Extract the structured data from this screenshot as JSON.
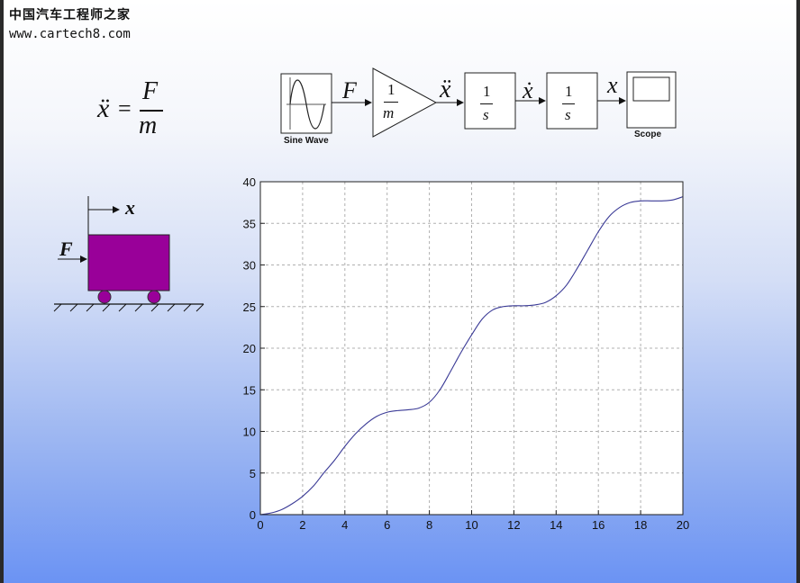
{
  "watermark": {
    "title": "中国汽车工程师之家",
    "url": "www.cartech8.com"
  },
  "equation": {
    "lhs": "ẍ",
    "eq": "=",
    "num": "F",
    "den": "m"
  },
  "block_diagram": {
    "source_label": "Sine Wave",
    "sink_label": "Scope",
    "signals": {
      "force": "F",
      "accel": "ẍ",
      "vel": "ẋ",
      "pos": "x"
    },
    "gain": {
      "num": "1",
      "den": "m"
    },
    "integrator1": {
      "num": "1",
      "den": "s"
    },
    "integrator2": {
      "num": "1",
      "den": "s"
    }
  },
  "cart": {
    "force_label": "F",
    "position_label": "x",
    "body_color": "#990099"
  },
  "chart_data": {
    "type": "line",
    "x": [
      0,
      0.5,
      1,
      1.5,
      2,
      2.5,
      3,
      3.5,
      4,
      4.5,
      5,
      5.5,
      6,
      6.5,
      7,
      7.5,
      8,
      8.5,
      9,
      9.5,
      10,
      10.5,
      11,
      11.5,
      12,
      12.5,
      13,
      13.5,
      14,
      14.5,
      15,
      15.5,
      16,
      16.5,
      17,
      17.5,
      18,
      18.5,
      19,
      19.5,
      20
    ],
    "y": [
      0,
      0.2,
      0.6,
      1.3,
      2.2,
      3.4,
      5.0,
      6.5,
      8.2,
      9.7,
      10.9,
      11.8,
      12.3,
      12.5,
      12.6,
      12.8,
      13.5,
      15.0,
      17.2,
      19.5,
      21.6,
      23.5,
      24.6,
      25.0,
      25.1,
      25.1,
      25.2,
      25.5,
      26.3,
      27.6,
      29.6,
      31.8,
      34.0,
      35.8,
      36.9,
      37.5,
      37.7,
      37.7,
      37.7,
      37.8,
      38.2
    ],
    "xlim": [
      0,
      20
    ],
    "ylim": [
      0,
      40
    ],
    "xticks": [
      0,
      2,
      4,
      6,
      8,
      10,
      12,
      14,
      16,
      18,
      20
    ],
    "yticks": [
      0,
      5,
      10,
      15,
      20,
      25,
      30,
      35,
      40
    ],
    "grid": true,
    "line_color": "#3a3a96"
  }
}
